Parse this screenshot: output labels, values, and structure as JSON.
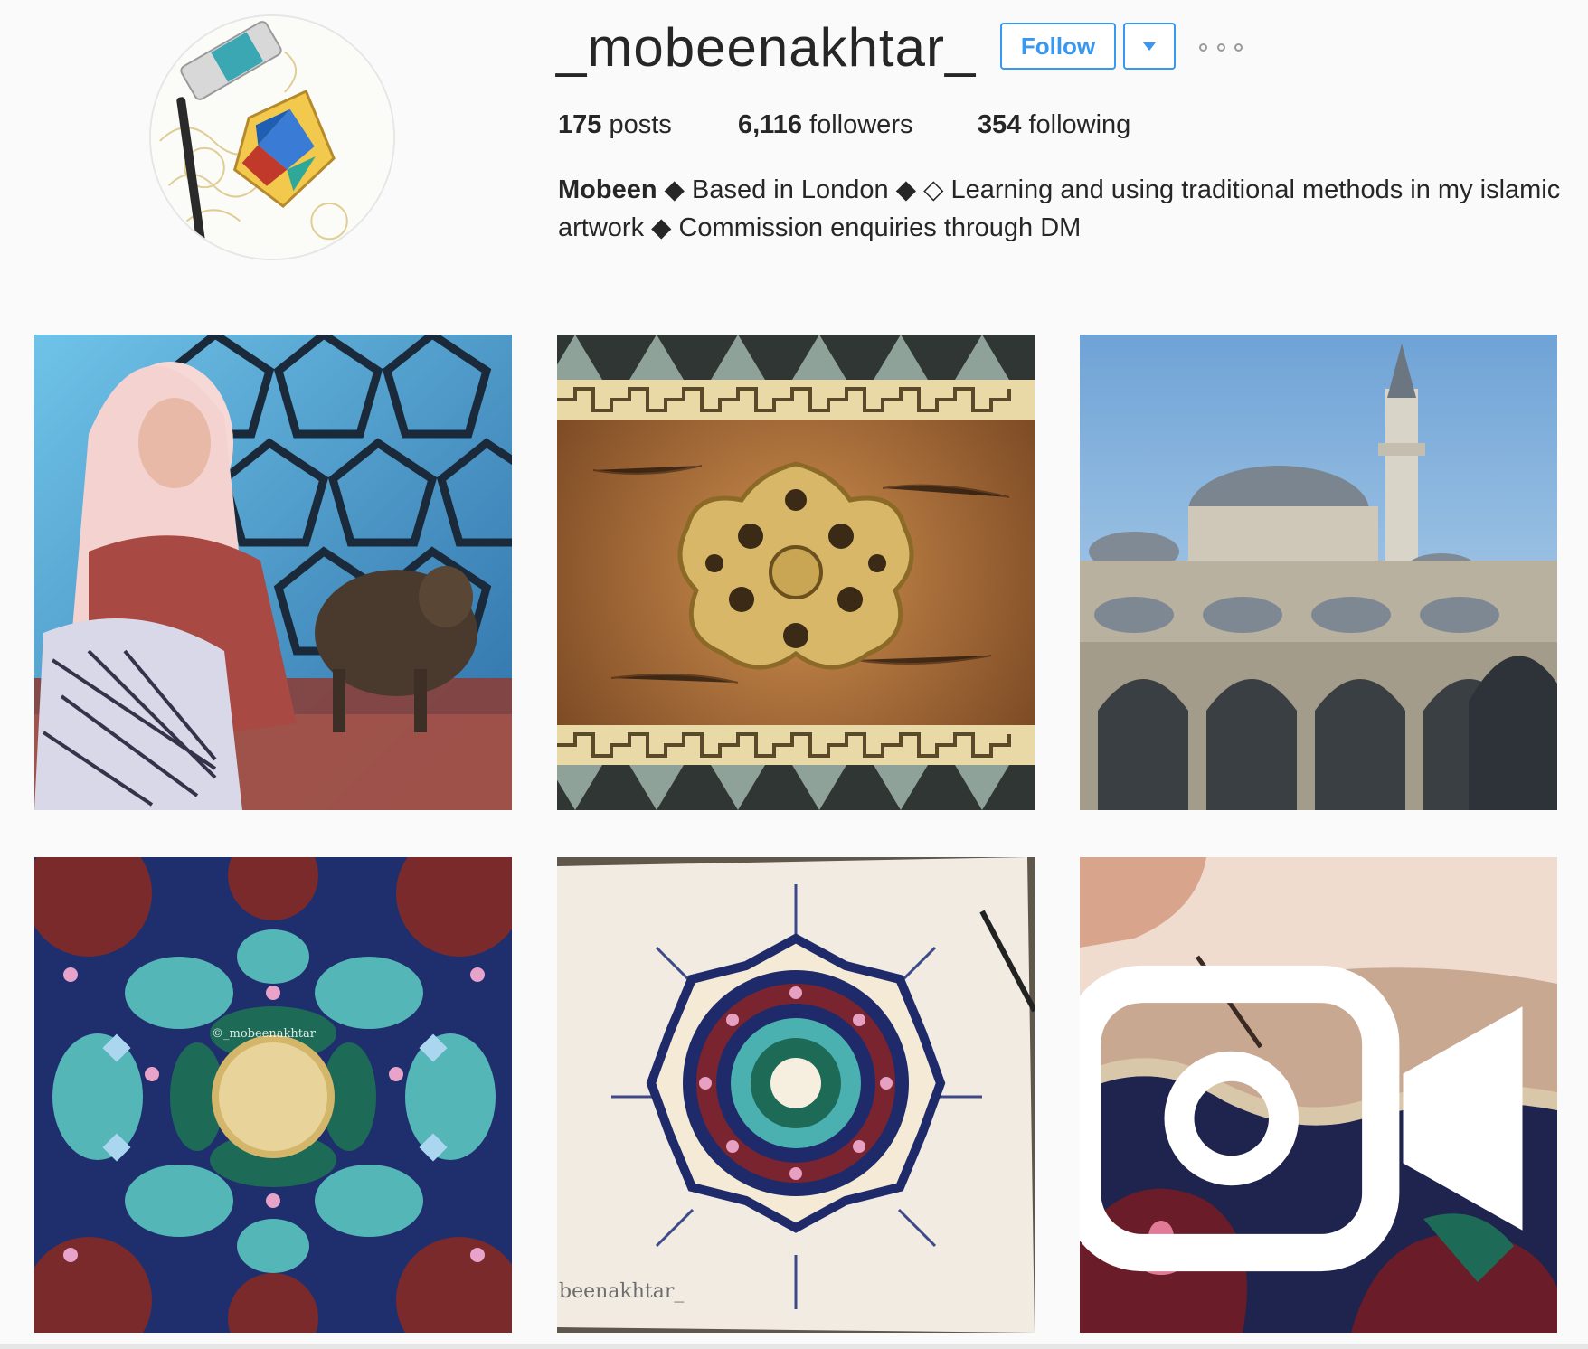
{
  "profile": {
    "username": "_mobeenakhtar_",
    "follow_label": "Follow",
    "stats": {
      "posts_count": "175",
      "posts_label": " posts",
      "followers_count": "6,116",
      "followers_label": " followers",
      "following_count": "354",
      "following_label": " following"
    },
    "bio": {
      "name": "Mobeen",
      "text": " ◆ Based in London ◆ ◇ Learning and using traditional methods in my islamic artwork ◆ Commission enquiries through DM"
    }
  },
  "posts": [
    {
      "watermark": ""
    },
    {
      "watermark": ""
    },
    {
      "watermark": ""
    },
    {
      "watermark": "©_mobeenakhtar"
    },
    {
      "watermark": "beenakhtar_"
    },
    {
      "watermark": "",
      "is_video": true
    }
  ],
  "colors": {
    "accent": "#3897f0",
    "text": "#262626",
    "background": "#fafafa"
  },
  "icons": {
    "more": "ellipsis-icon",
    "dropdown": "caret-down-icon",
    "video": "video-camera-icon"
  }
}
